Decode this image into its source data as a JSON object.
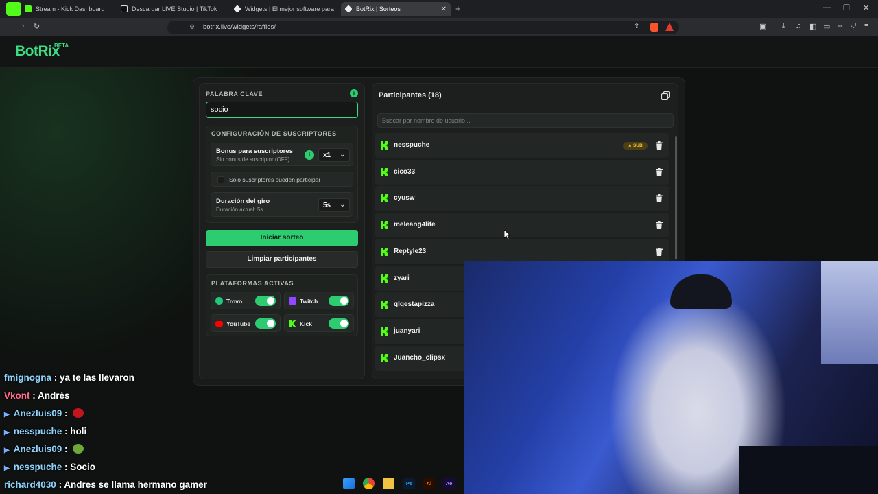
{
  "browser": {
    "tabs": [
      {
        "title": "Stream - Kick Dashboard",
        "active": false
      },
      {
        "title": "Descargar LIVE Studio | TikTok",
        "active": false
      },
      {
        "title": "Widgets | El mejor software para pot",
        "active": false
      },
      {
        "title": "BotRix | Sorteos",
        "active": true
      }
    ],
    "url": "botrix.live/widgets/raffles/"
  },
  "app": {
    "logo": "BotRix",
    "beta": "BETA"
  },
  "raffle": {
    "keyword_label": "PALABRA CLAVE",
    "keyword_value": "socio",
    "subs_config": {
      "title": "CONFIGURACIÓN DE SUSCRIPTORES",
      "bonus_title": "Bonus para suscriptores",
      "bonus_sub": "Sin bonus de suscriptor (OFF)",
      "bonus_value": "x1",
      "only_subs_label": "Solo suscriptores pueden participar",
      "duration_title": "Duración del giro",
      "duration_sub": "Duración actual: 5s",
      "duration_value": "5s"
    },
    "start_button": "Iniciar sorteo",
    "clear_button": "Limpiar participantes",
    "platforms": {
      "title": "PLATAFORMAS ACTIVAS",
      "items": [
        {
          "name": "Trovo",
          "enabled": true,
          "color": "#1fcb7a"
        },
        {
          "name": "Twitch",
          "enabled": true,
          "color": "#9146ff"
        },
        {
          "name": "YouTube",
          "enabled": true,
          "color": "#ff0000"
        },
        {
          "name": "Kick",
          "enabled": true,
          "color": "#53fc18"
        }
      ]
    }
  },
  "participants": {
    "title": "Participantes (18)",
    "search_placeholder": "Buscar por nombre de usuario...",
    "sub_badge": "SUB",
    "list": [
      {
        "name": "nesspuche",
        "sub": true
      },
      {
        "name": "cico33",
        "sub": false
      },
      {
        "name": "cyusw",
        "sub": false
      },
      {
        "name": "meleang4life",
        "sub": false
      },
      {
        "name": "Reptyle23",
        "sub": false
      },
      {
        "name": "zyari",
        "sub": false
      },
      {
        "name": "qlqestapizza",
        "sub": false
      },
      {
        "name": "juanyari",
        "sub": false
      },
      {
        "name": "Juancho_clipsx",
        "sub": false
      }
    ]
  },
  "chat": [
    {
      "user": "fmignogna",
      "message": "ya te las llevaron",
      "color": "#8fd3ff",
      "badge": false
    },
    {
      "user": "Vkont",
      "message": "Andrés",
      "color": "#ff6b8a",
      "badge": false
    },
    {
      "user": "Anezluis09",
      "message": "",
      "color": "#8fd3ff",
      "badge": true,
      "emote": "red"
    },
    {
      "user": "nesspuche",
      "message": "holi",
      "color": "#8fd3ff",
      "badge": true
    },
    {
      "user": "Anezluis09",
      "message": "",
      "color": "#8fd3ff",
      "badge": true,
      "emote": "green"
    },
    {
      "user": "nesspuche",
      "message": "Socio",
      "color": "#8fd3ff",
      "badge": true
    },
    {
      "user": "richard4030",
      "message": "Andres se llama hermano gamer",
      "color": "#8fd3ff",
      "badge": false
    }
  ],
  "taskbar": {
    "apps": [
      "windows-start",
      "chrome",
      "file-explorer",
      "Ps",
      "Ai",
      "Ae"
    ]
  }
}
